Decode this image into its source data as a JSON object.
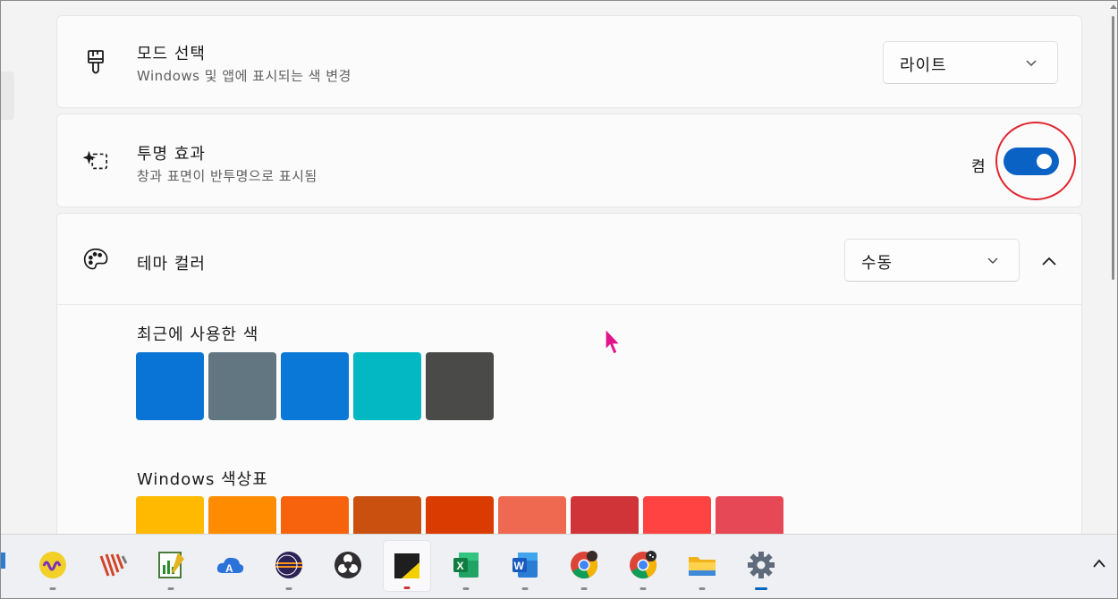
{
  "mode": {
    "icon": "paintbrush-icon",
    "title": "모드 선택",
    "description": "Windows 및 앱에 표시되는 색 변경",
    "selected": "라이트"
  },
  "transparency": {
    "icon": "transparency-effects-icon",
    "title": "투명 효과",
    "description": "창과 표면이 반투명으로 표시됨",
    "state_label": "켬",
    "on": true
  },
  "theme_color": {
    "icon": "palette-icon",
    "title": "테마 컬러",
    "selected": "수동",
    "recent_title": "최근에 사용한 색",
    "recent_colors": [
      "#0a74d6",
      "#627682",
      "#0a78d7",
      "#03b7c3",
      "#4a4a48"
    ],
    "palette_title": "Windows 색상표",
    "palette_colors": [
      "#ffb900",
      "#ff8c00",
      "#f7630c",
      "#ca5010",
      "#da3b01",
      "#ef6950",
      "#d13438",
      "#ff4343",
      "#e74856"
    ]
  },
  "taskbar": {
    "items": [
      {
        "icon": "circle-wave-app-icon",
        "dot": "gray"
      },
      {
        "icon": "stripes-app-icon",
        "dot": "none"
      },
      {
        "icon": "notepad-chart-app-icon",
        "dot": "gray"
      },
      {
        "icon": "cloud-a-app-icon",
        "dot": "none"
      },
      {
        "icon": "eclipse-app-icon",
        "dot": "gray"
      },
      {
        "icon": "obs-icon",
        "dot": "none"
      },
      {
        "icon": "sticky-notes-icon",
        "dot": "red"
      },
      {
        "icon": "excel-icon",
        "dot": "gray"
      },
      {
        "icon": "word-icon",
        "dot": "gray"
      },
      {
        "icon": "chrome-profile-1-icon",
        "dot": "gray"
      },
      {
        "icon": "chrome-profile-2-icon",
        "dot": "gray"
      },
      {
        "icon": "file-explorer-icon",
        "dot": "gray"
      },
      {
        "icon": "settings-gear-icon",
        "dot": "blue"
      }
    ],
    "overflow_icon": "chevron-up-icon"
  },
  "colors": {
    "accent": "#0a62c4",
    "highlight_circle": "#e0252f",
    "cursor": "#e2138b"
  }
}
